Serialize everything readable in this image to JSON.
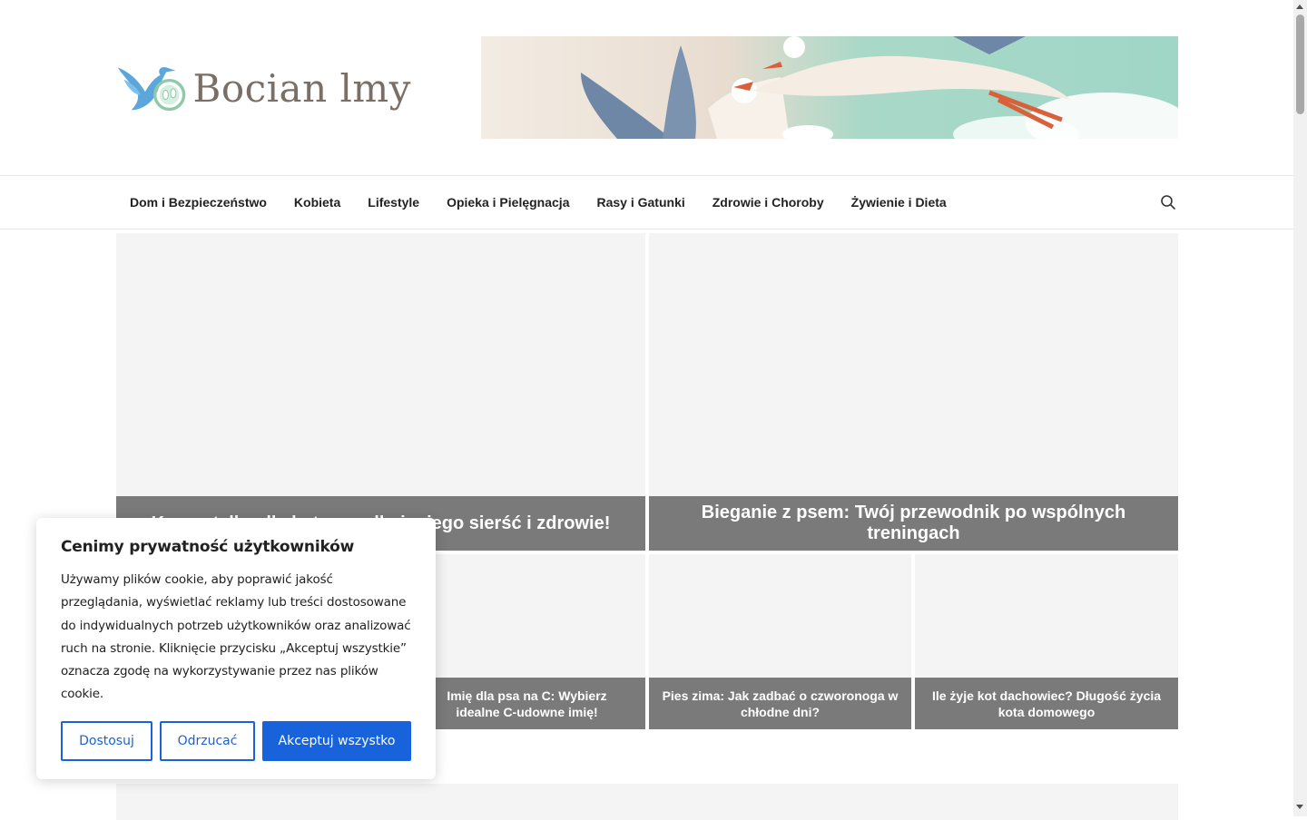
{
  "site": {
    "logo_text": "Bocian lmy"
  },
  "nav": {
    "items": [
      "Dom i Bezpieczeństwo",
      "Kobieta",
      "Lifestyle",
      "Opieka i Pielęgnacja",
      "Rasy i Gatunki",
      "Zdrowie i Choroby",
      "Żywienie i Dieta"
    ],
    "search_icon": "search-icon"
  },
  "posts": {
    "big": [
      "Karma tylko dla kota – zadbaj o jego sierść i zdrowie!",
      "Bieganie z psem: Twój przewodnik po wspólnych treningach"
    ],
    "small": [
      "Imię dla psa na C: Wybierz idealne C-udowne imię!",
      "Pies zima: Jak zadbać o czworonoga w chłodne dni?",
      "Ile żyje kot dachowiec? Długość życia kota domowego"
    ]
  },
  "cookie": {
    "title": "Cenimy prywatność użytkowników",
    "text": "Używamy plików cookie, aby poprawić jakość przeglądania, wyświetlać reklamy lub treści dostosowane do indywidualnych potrzeb użytkowników oraz analizować ruch na stronie. Kliknięcie przycisku „Akceptuj wszystkie” oznacza zgodę na wykorzystywanie przez nas plików cookie.",
    "customize": "Dostosuj",
    "reject": "Odrzucać",
    "accept": "Akceptuj wszystko"
  },
  "colors": {
    "accent": "#1863dc",
    "caption_bg": "#7a7a7a",
    "placeholder_bg": "#f4f4f4"
  }
}
